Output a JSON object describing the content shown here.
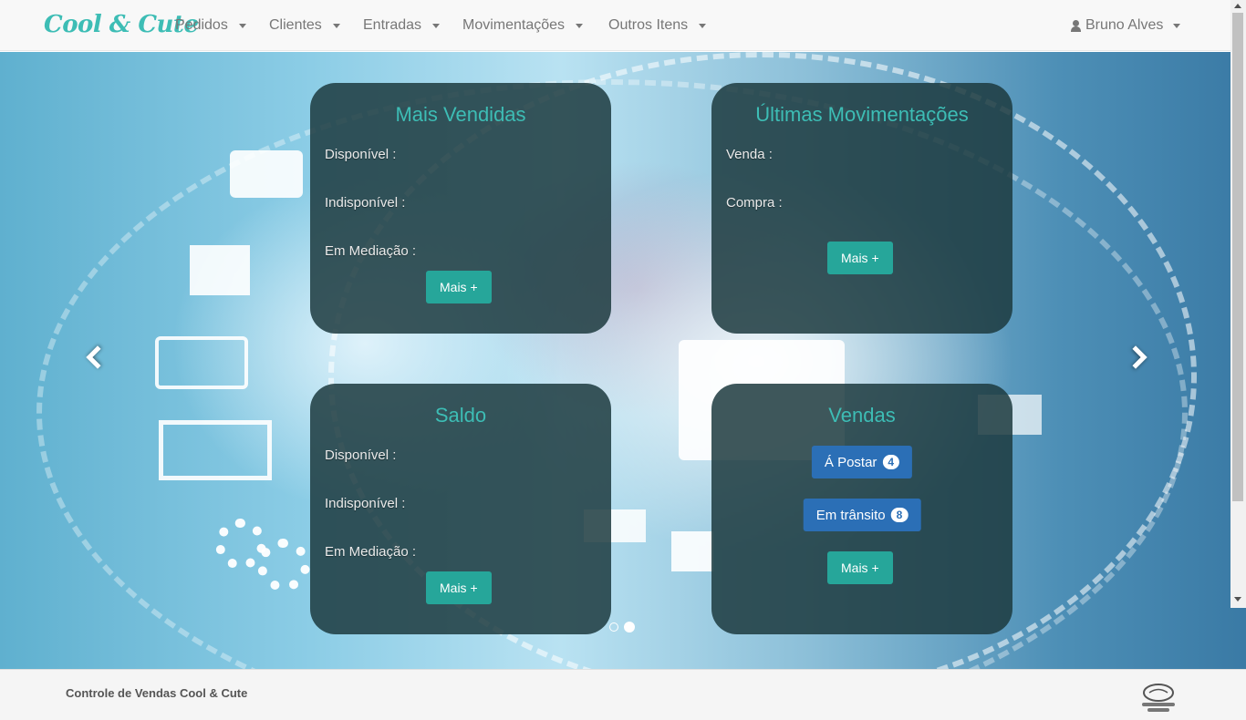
{
  "navbar": {
    "brand": "Cool & Cute",
    "menu": [
      {
        "label": "Pedidos"
      },
      {
        "label": "Clientes"
      },
      {
        "label": "Entradas"
      },
      {
        "label": "Movimentações"
      },
      {
        "label": "Outros Itens"
      }
    ],
    "user": "Bruno Alves"
  },
  "panels": {
    "mais_vendidas": {
      "title": "Mais Vendidas",
      "labels": [
        "Disponível :",
        "Indisponível :",
        "Em Mediação :"
      ],
      "button": "Mais +"
    },
    "ultimas_movimentacoes": {
      "title": "Últimas Movimentações",
      "labels": [
        "Venda :",
        "Compra :"
      ],
      "button": "Mais +"
    },
    "saldo": {
      "title": "Saldo",
      "labels": [
        "Disponível :",
        "Indisponível :",
        "Em Mediação :"
      ],
      "button": "Mais +"
    },
    "vendas": {
      "title": "Vendas",
      "a_postar": {
        "label": "Á Postar",
        "count": "4"
      },
      "em_transito": {
        "label": "Em trânsito",
        "count": "8"
      },
      "button": "Mais +"
    }
  },
  "carousel": {
    "slide_count": 2,
    "active_slide": 2
  },
  "footer": {
    "text": "Controle de Vendas Cool & Cute",
    "logo_icon": "mercado-livre-logo"
  },
  "colors": {
    "brand": "#3dbdb5",
    "panel_bg": "#1c3a3e",
    "teal_button": "#26a69a",
    "blue_button": "#2b6fb6"
  }
}
